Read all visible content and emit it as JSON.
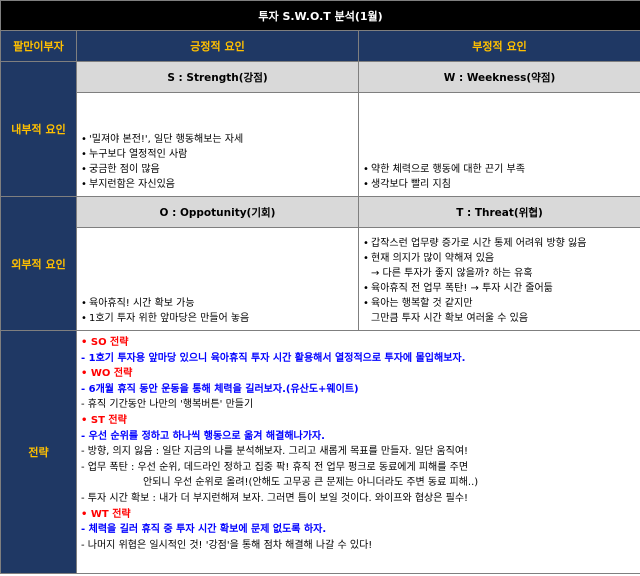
{
  "title": "투자 S.W.O.T 분석(1월)",
  "header": {
    "corner": "팔만이부자",
    "positive": "긍정적 요인",
    "negative": "부정적 요인"
  },
  "internal": {
    "label": "내부적 요인",
    "strength_title": "S : Strength(강점)",
    "weakness_title": "W : Weekness(약점)",
    "strengths": [
      "'밀져야 본전!', 일단 행동해보는 자세",
      "누구보다 열정적인 사람",
      "궁금한 점이 많음",
      "부지런함은 자신있음"
    ],
    "weaknesses": [
      "약한 체력으로 행동에 대한 끈기 부족",
      "생각보다 빨리 지침"
    ]
  },
  "external": {
    "label": "외부적 요인",
    "opportunity_title": "O : Oppotunity(기회)",
    "threat_title": "T : Threat(위협)",
    "opportunities": [
      "육아휴직! 시간 확보 가능",
      "1호기 투자 위한 앞마당은 만들어 놓음"
    ],
    "threats": [
      {
        "text": "갑작스런 업무량 증가로 시간 통제 어려워 방향 잃음",
        "bullet": true
      },
      {
        "text": "현재 의지가 많이 약해져 있음",
        "bullet": true
      },
      {
        "text": "→ 다른 투자가 좋지 않을까? 하는 유혹",
        "bullet": false
      },
      {
        "text": "육아휴직 전 업무 폭탄! → 투자 시간 줄어듦",
        "bullet": true
      },
      {
        "text": "육아는 행복할 것 같지만",
        "bullet": true
      },
      {
        "text": "그만큼 투자 시간 확보 여러울 수 있음",
        "bullet": false
      }
    ]
  },
  "strategy": {
    "label": "전략",
    "lines": [
      {
        "style": "title",
        "text": "• SO 전략"
      },
      {
        "style": "main",
        "text": " - 1호기 투자용 앞마당 있으니 육아휴직 투자 시간 활용해서 열정적으로 투자에 몰입해보자."
      },
      {
        "style": "title",
        "text": "• WO 전략"
      },
      {
        "style": "main",
        "text": " - 6개월 휴직 동안 운동을 통해 체력을 길러보자.(유산도+웨이트)"
      },
      {
        "style": "plain",
        "text": " - 휴직 기간동안 나만의 '행복버튼' 만들기"
      },
      {
        "style": "title",
        "text": "• ST 전략"
      },
      {
        "style": "main",
        "text": " - 우선 순위를 정하고 하나씩 행동으로 옮겨 해결해나가자."
      },
      {
        "style": "plain",
        "text": " - 방향, 의지 잃음 : 일단 지금의 나를 분석해보자. 그리고 새롭게 목표를 만들자. 일단 움직여!"
      },
      {
        "style": "plain",
        "text": " - 업무 폭탄 : 우선 순위, 데드라인 정하고 집중 팍! 휴직 전 업무 펑크로 동료에게 피해를 주면"
      },
      {
        "style": "indent",
        "text": "안되니 우선 순위로 올려!(안해도 고무공 큰 문제는 아니더라도 주변 동료 피해..)"
      },
      {
        "style": "plain",
        "text": " - 투자 시간 확보 : 내가 더 부지런해져 보자. 그러면 틈이 보일 것이다. 와이프와 협상은 필수!"
      },
      {
        "style": "title",
        "text": "• WT 전략"
      },
      {
        "style": "main",
        "text": " - 체력을 길러 휴직 중 투자 시간 확보에 문제 없도록 하자."
      },
      {
        "style": "plain",
        "text": " - 나머지 위협은 일시적인 것! '강점'을 통해 점차 해결해 나갈 수 있다!"
      }
    ]
  },
  "colors": {
    "title_bg": "#000000",
    "header_bg": "#1f3864",
    "header_text": "#ffc000",
    "sub_bg": "#d9d9d9",
    "strategy_title": "#ff0000",
    "strategy_main": "#0000ff"
  }
}
